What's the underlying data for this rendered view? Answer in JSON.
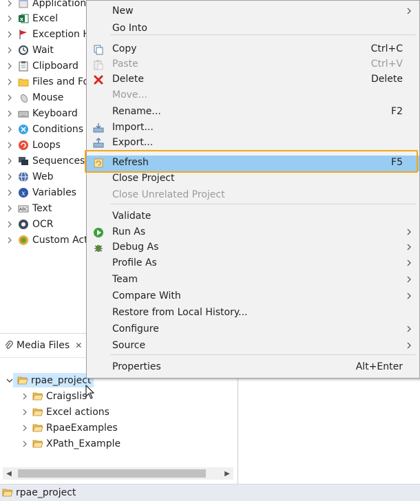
{
  "palette": {
    "items": [
      {
        "label": "Application",
        "icon": "application-icon"
      },
      {
        "label": "Excel",
        "icon": "excel-icon"
      },
      {
        "label": "Exception H",
        "icon": "flag-icon"
      },
      {
        "label": "Wait",
        "icon": "clock-icon"
      },
      {
        "label": "Clipboard",
        "icon": "clipboard-icon"
      },
      {
        "label": "Files and Fo",
        "icon": "folder-icon"
      },
      {
        "label": "Mouse",
        "icon": "mouse-icon"
      },
      {
        "label": "Keyboard",
        "icon": "keyboard-icon"
      },
      {
        "label": "Conditions",
        "icon": "conditions-icon"
      },
      {
        "label": "Loops",
        "icon": "loops-icon"
      },
      {
        "label": "Sequences",
        "icon": "sequences-icon"
      },
      {
        "label": "Web",
        "icon": "globe-icon"
      },
      {
        "label": "Variables",
        "icon": "variables-icon"
      },
      {
        "label": "Text",
        "icon": "text-icon"
      },
      {
        "label": "OCR",
        "icon": "ocr-icon"
      },
      {
        "label": "Custom Acti",
        "icon": "custom-actions-icon"
      }
    ]
  },
  "media_view": {
    "tab_label": "Media Files",
    "tab_close": "✕",
    "root": "rpae_project",
    "children": [
      "Craigslis",
      "Excel actions",
      "RpaeExamples",
      "XPath_Example"
    ]
  },
  "statusbar": {
    "label": "rpae_project"
  },
  "context_menu": {
    "items": [
      {
        "label": "New",
        "shortcut": "",
        "submenu": true,
        "disabled": false,
        "icon": ""
      },
      {
        "label": "Go Into",
        "shortcut": "",
        "submenu": false,
        "disabled": false,
        "icon": ""
      },
      {
        "label": "Copy",
        "shortcut": "Ctrl+C",
        "submenu": false,
        "disabled": false,
        "icon": "copy-icon"
      },
      {
        "label": "Paste",
        "shortcut": "Ctrl+V",
        "submenu": false,
        "disabled": true,
        "icon": "paste-icon"
      },
      {
        "label": "Delete",
        "shortcut": "Delete",
        "submenu": false,
        "disabled": false,
        "icon": "delete-icon"
      },
      {
        "label": "Move...",
        "shortcut": "",
        "submenu": false,
        "disabled": true,
        "icon": ""
      },
      {
        "label": "Rename...",
        "shortcut": "F2",
        "submenu": false,
        "disabled": false,
        "icon": ""
      },
      {
        "label": "Import...",
        "shortcut": "",
        "submenu": false,
        "disabled": false,
        "icon": "import-icon"
      },
      {
        "label": "Export...",
        "shortcut": "",
        "submenu": false,
        "disabled": false,
        "icon": "export-icon"
      },
      {
        "label": "Refresh",
        "shortcut": "F5",
        "submenu": false,
        "disabled": false,
        "icon": "refresh-icon",
        "highlighted": true
      },
      {
        "label": "Close Project",
        "shortcut": "",
        "submenu": false,
        "disabled": false,
        "icon": ""
      },
      {
        "label": "Close Unrelated Project",
        "shortcut": "",
        "submenu": false,
        "disabled": true,
        "icon": ""
      },
      {
        "label": "Validate",
        "shortcut": "",
        "submenu": false,
        "disabled": false,
        "icon": ""
      },
      {
        "label": "Run As",
        "shortcut": "",
        "submenu": true,
        "disabled": false,
        "icon": "run-icon"
      },
      {
        "label": "Debug As",
        "shortcut": "",
        "submenu": true,
        "disabled": false,
        "icon": "bug-icon"
      },
      {
        "label": "Profile As",
        "shortcut": "",
        "submenu": true,
        "disabled": false,
        "icon": ""
      },
      {
        "label": "Team",
        "shortcut": "",
        "submenu": true,
        "disabled": false,
        "icon": ""
      },
      {
        "label": "Compare With",
        "shortcut": "",
        "submenu": true,
        "disabled": false,
        "icon": ""
      },
      {
        "label": "Restore from Local History...",
        "shortcut": "",
        "submenu": false,
        "disabled": false,
        "icon": ""
      },
      {
        "label": "Configure",
        "shortcut": "",
        "submenu": true,
        "disabled": false,
        "icon": ""
      },
      {
        "label": "Source",
        "shortcut": "",
        "submenu": true,
        "disabled": false,
        "icon": ""
      },
      {
        "label": "Properties",
        "shortcut": "Alt+Enter",
        "submenu": false,
        "disabled": false,
        "icon": ""
      }
    ]
  },
  "colors": {
    "highlight": "#99ccf2",
    "highlight_outline": "#f2a818",
    "selection": "#cce8ff",
    "statusbar": "#e7eaf0"
  }
}
